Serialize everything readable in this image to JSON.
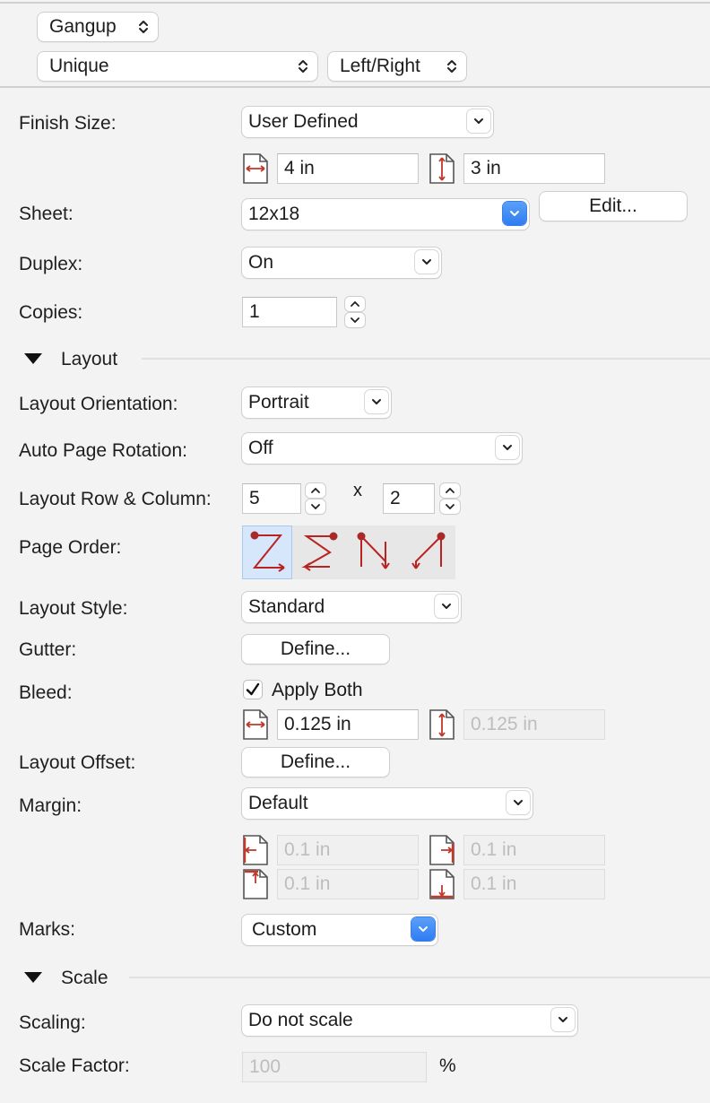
{
  "top": {
    "mode": "Gangup",
    "type": "Unique",
    "direction": "Left/Right"
  },
  "finish_size": {
    "label": "Finish Size:",
    "value": "User Defined",
    "width": "4 in",
    "height": "3 in"
  },
  "sheet": {
    "label": "Sheet:",
    "value": "12x18",
    "edit_label": "Edit..."
  },
  "duplex": {
    "label": "Duplex:",
    "value": "On"
  },
  "copies": {
    "label": "Copies:",
    "value": "1"
  },
  "layout": {
    "title": "Layout",
    "orientation_label": "Layout Orientation:",
    "orientation": "Portrait",
    "auto_rotation_label": "Auto Page Rotation:",
    "auto_rotation": "Off",
    "row_col_label": "Layout Row & Column:",
    "rows": "5",
    "x_label": "x",
    "columns": "2",
    "page_order_label": "Page Order:",
    "style_label": "Layout Style:",
    "style": "Standard",
    "gutter_label": "Gutter:",
    "gutter_button": "Define...",
    "bleed_label": "Bleed:",
    "apply_both_label": "Apply Both",
    "bleed_h": "0.125 in",
    "bleed_v": "0.125 in",
    "offset_label": "Layout Offset:",
    "offset_button": "Define...",
    "margin_label": "Margin:",
    "margin": "Default",
    "margin_left": "0.1 in",
    "margin_right": "0.1 in",
    "margin_top": "0.1 in",
    "margin_bottom": "0.1 in",
    "marks_label": "Marks:",
    "marks": "Custom"
  },
  "scale": {
    "title": "Scale",
    "scaling_label": "Scaling:",
    "scaling": "Do not scale",
    "factor_label": "Scale Factor:",
    "factor_placeholder": "100",
    "unit": "%"
  },
  "colors": {
    "accent": "#2f7cf3",
    "icon_red": "#c0392b"
  }
}
